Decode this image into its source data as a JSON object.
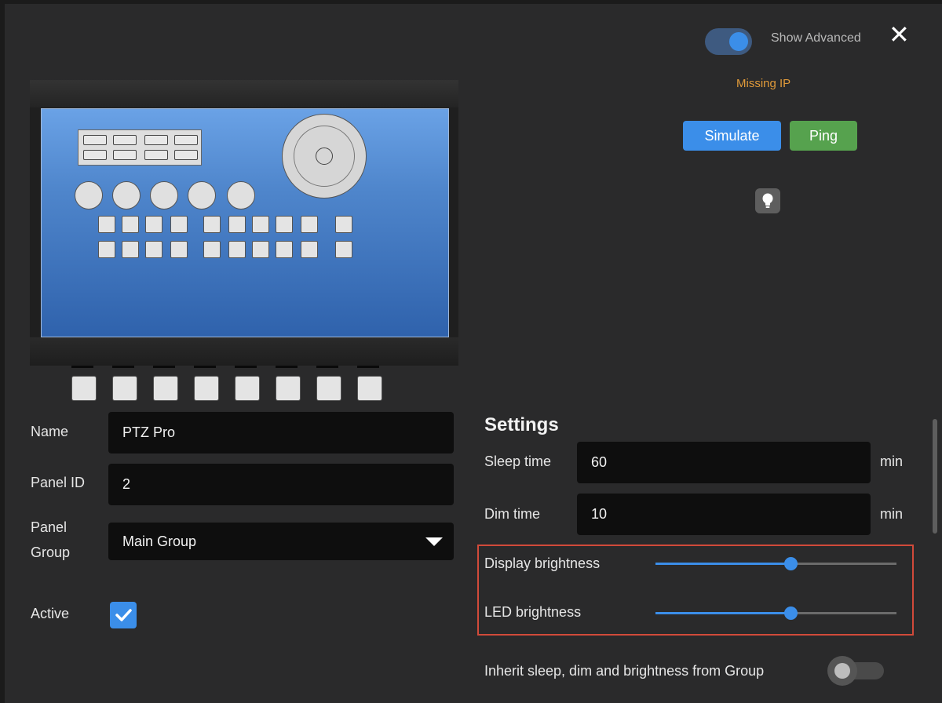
{
  "header": {
    "show_advanced_label": "Show Advanced",
    "show_advanced_on": true,
    "close_glyph": "✕",
    "status_text": "Missing IP",
    "simulate_label": "Simulate",
    "ping_label": "Ping",
    "identify_icon": "lightbulb-icon"
  },
  "colors": {
    "accent": "#3b8ee9",
    "ping": "#56a24e",
    "warning": "#e09a3a",
    "highlight_box": "#d14a3a"
  },
  "form": {
    "name_label": "Name",
    "name_value": "PTZ Pro",
    "panel_id_label": "Panel ID",
    "panel_id_value": "2",
    "panel_group_label_1": "Panel",
    "panel_group_label_2": "Group",
    "panel_group_value": "Main Group",
    "active_label": "Active",
    "active_checked": true
  },
  "settings": {
    "heading": "Settings",
    "sleep_label": "Sleep time",
    "sleep_value": "60",
    "sleep_unit": "min",
    "dim_label": "Dim time",
    "dim_value": "10",
    "dim_unit": "min",
    "display_brightness_label": "Display brightness",
    "display_brightness_level": 0.56,
    "led_brightness_label": "LED brightness",
    "led_brightness_level": 0.56,
    "inherit_label": "Inherit sleep, dim and brightness from Group",
    "inherit_on": false
  }
}
